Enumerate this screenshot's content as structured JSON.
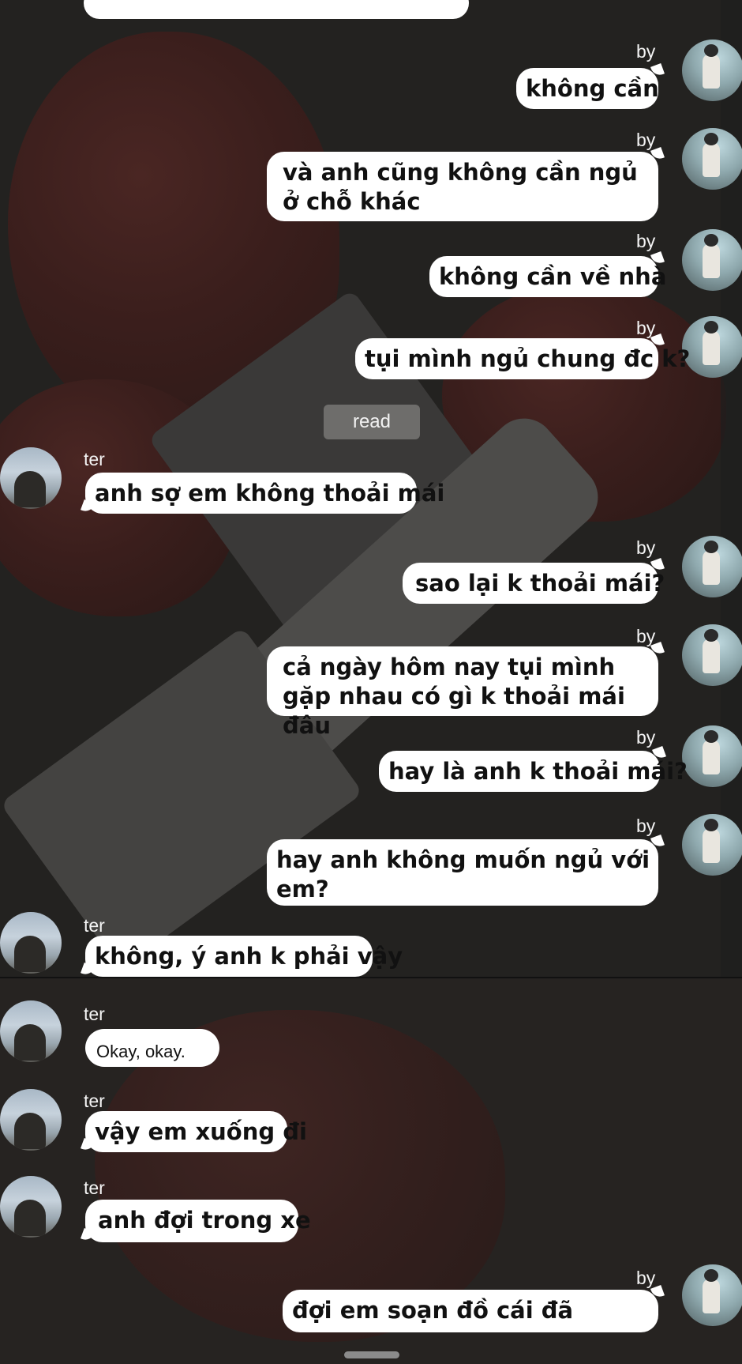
{
  "chat": {
    "me_name": "by",
    "other_name": "ter",
    "read_label": "read",
    "top_partial_text": "",
    "messages": [
      {
        "id": "m1",
        "from": "me",
        "text": "không cần"
      },
      {
        "id": "m2",
        "from": "me",
        "text": "và anh cũng không cần ngủ ở chỗ khác"
      },
      {
        "id": "m3",
        "from": "me",
        "text": "không cần về nhà"
      },
      {
        "id": "m4",
        "from": "me",
        "text": "tụi mình ngủ chung đc k?"
      },
      {
        "id": "m5",
        "from": "other",
        "text": "anh sợ em không thoải mái"
      },
      {
        "id": "m6",
        "from": "me",
        "text": "sao lại k thoải mái?"
      },
      {
        "id": "m7",
        "from": "me",
        "text": "cả ngày hôm nay tụi mình gặp nhau có gì k thoải mái đâu"
      },
      {
        "id": "m8",
        "from": "me",
        "text": "hay là anh k thoải mái?"
      },
      {
        "id": "m9",
        "from": "me",
        "text": "hay anh không muốn ngủ với em?"
      },
      {
        "id": "m10",
        "from": "other",
        "text": "không, ý anh k phải vậy"
      },
      {
        "id": "m11",
        "from": "other",
        "text": "Okay, okay."
      },
      {
        "id": "m12",
        "from": "other",
        "text": "vậy em xuống đi"
      },
      {
        "id": "m13",
        "from": "other",
        "text": "anh đợi trong xe"
      },
      {
        "id": "m14",
        "from": "me",
        "text": "đợi em soạn đồ cái đã"
      }
    ]
  },
  "icons": {
    "avatar_me": "avatar-me-icon",
    "avatar_other": "avatar-other-icon"
  }
}
